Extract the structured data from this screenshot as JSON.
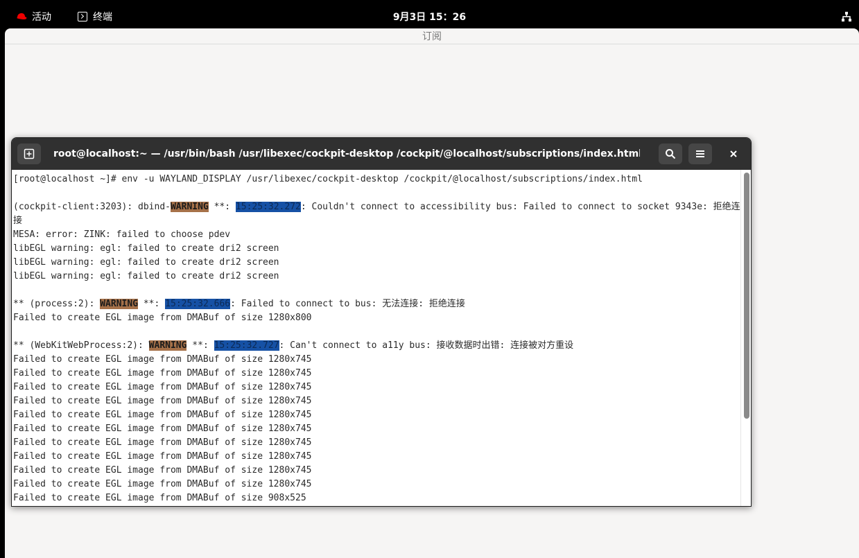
{
  "topbar": {
    "activities": "活动",
    "app": "终端",
    "clock": "9月3日 15：26"
  },
  "browser": {
    "title": "订阅"
  },
  "terminal": {
    "title": "root@localhost:~ — /usr/bin/bash /usr/libexec/cockpit-desktop /cockpit/@localhost/subscriptions/index.html",
    "lines": {
      "l1": "[root@localhost ~]# env -u WAYLAND_DISPLAY /usr/libexec/cockpit-desktop /cockpit/@localhost/subscriptions/index.html",
      "l3a": "(cockpit-client:3203): dbind-",
      "l3w": "WARNING",
      "l3b": " **: ",
      "l3t": "15:25:32.272",
      "l3c": ": Couldn't connect to accessibility bus: Failed to connect to socket 9343e: 拒绝连接",
      "l4": "MESA: error: ZINK: failed to choose pdev",
      "l5": "libEGL warning: egl: failed to create dri2 screen",
      "l6": "libEGL warning: egl: failed to create dri2 screen",
      "l7": "libEGL warning: egl: failed to create dri2 screen",
      "l9a": "** (process:2): ",
      "l9w": "WARNING",
      "l9b": " **: ",
      "l9t": "15:25:32.666",
      "l9c": ": Failed to connect to bus: 无法连接: 拒绝连接",
      "l10": "Failed to create EGL image from DMABuf of size 1280x800",
      "l12a": "** (WebKitWebProcess:2): ",
      "l12w": "WARNING",
      "l12b": " **: ",
      "l12t": "15:25:32.727",
      "l12c": ": Can't connect to a11y bus: 接收数据时出错: 连接被对方重设",
      "r1": "Failed to create EGL image from DMABuf of size 1280x745",
      "r2": "Failed to create EGL image from DMABuf of size 1280x745",
      "r3": "Failed to create EGL image from DMABuf of size 1280x745",
      "r4": "Failed to create EGL image from DMABuf of size 1280x745",
      "r5": "Failed to create EGL image from DMABuf of size 1280x745",
      "r6": "Failed to create EGL image from DMABuf of size 1280x745",
      "r7": "Failed to create EGL image from DMABuf of size 1280x745",
      "r8": "Failed to create EGL image from DMABuf of size 1280x745",
      "r9": "Failed to create EGL image from DMABuf of size 1280x745",
      "r10": "Failed to create EGL image from DMABuf of size 1280x745",
      "r11": "Failed to create EGL image from DMABuf of size 908x525"
    }
  },
  "icons": {
    "activities": "redhat-hat-icon",
    "app": "terminal-icon",
    "network": "network-wired-icon",
    "new_tab": "new-tab-icon",
    "search": "search-icon",
    "menu": "hamburger-menu-icon",
    "close": "close-icon"
  },
  "colors": {
    "warning_highlight": "#a67149",
    "timestamp_highlight": "#1651a5",
    "header_bg": "#303030"
  }
}
